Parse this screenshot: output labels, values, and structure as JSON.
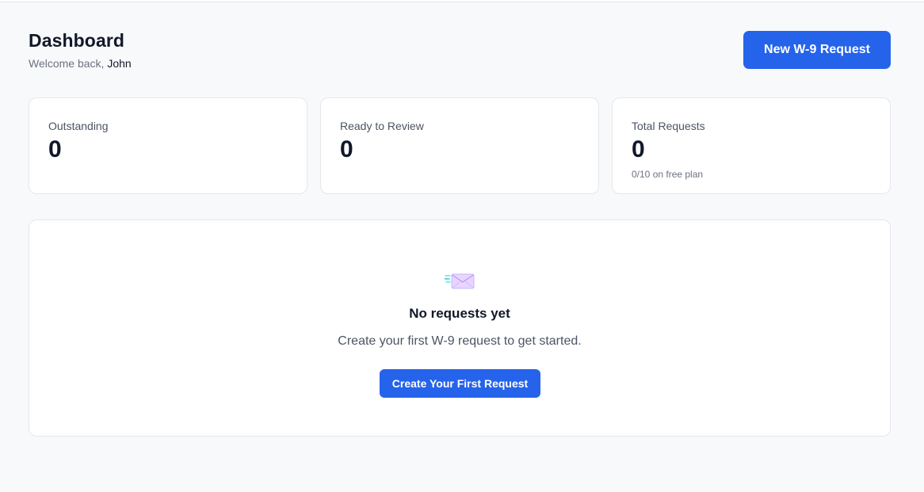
{
  "header": {
    "title": "Dashboard",
    "welcome_prefix": "Welcome back, ",
    "user_name": "John",
    "new_request_label": "New W-9 Request"
  },
  "stats": [
    {
      "label": "Outstanding",
      "value": "0",
      "note": ""
    },
    {
      "label": "Ready to Review",
      "value": "0",
      "note": ""
    },
    {
      "label": "Total Requests",
      "value": "0",
      "note": "0/10 on free plan"
    }
  ],
  "empty_state": {
    "icon": "envelope-icon",
    "title": "No requests yet",
    "description": "Create your first W-9 request to get started.",
    "cta_label": "Create Your First Request"
  },
  "colors": {
    "accent": "#2563eb",
    "background": "#f8f9fb",
    "card": "#ffffff",
    "border": "#e5e7eb"
  }
}
